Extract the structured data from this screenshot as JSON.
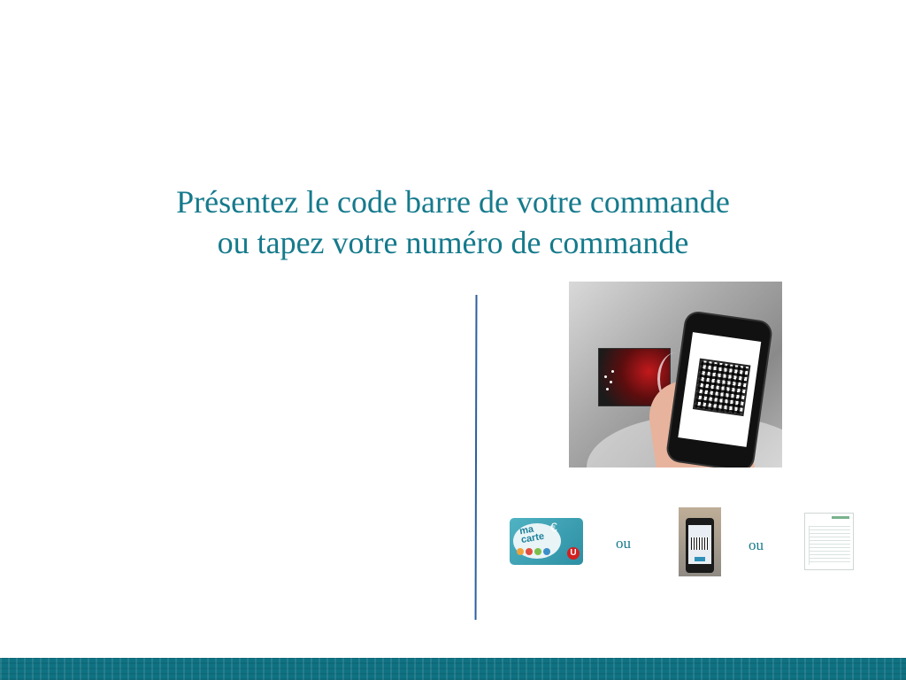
{
  "heading": {
    "line1": "Présentez le code barre de votre commande",
    "line2": "ou tapez votre numéro de commande"
  },
  "options": {
    "card": {
      "text_line1": "ma",
      "text_line2": "carte",
      "symbol": "€",
      "brand": "U",
      "icon": "loyalty-card-icon"
    },
    "separator_1": "ou",
    "mobile": {
      "icon": "mobile-barcode-icon"
    },
    "separator_2": "ou",
    "receipt": {
      "icon": "order-receipt-icon"
    }
  },
  "colors": {
    "accent": "#157a8c",
    "divider": "#2b5f9e",
    "footer": "#0f7282"
  }
}
